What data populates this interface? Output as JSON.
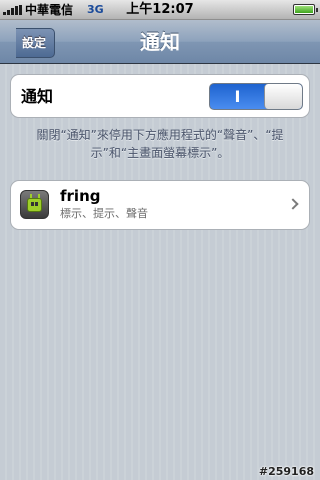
{
  "status_bar": {
    "carrier": "中華電信",
    "network": "3G",
    "time": "上午12:07"
  },
  "nav": {
    "back_label": "設定",
    "title": "通知"
  },
  "notifications_toggle": {
    "label": "通知",
    "on_text": "I",
    "state": "on",
    "accent": "#2f7ae5"
  },
  "footer_note": "關閉“通知”來停用下方應用程式的“聲音”、“提示”和“主畫面螢幕標示”。",
  "apps": [
    {
      "name": "fring",
      "detail": "標示、提示、聲音",
      "icon": "fring-app-icon"
    }
  ],
  "watermark": "#259168"
}
